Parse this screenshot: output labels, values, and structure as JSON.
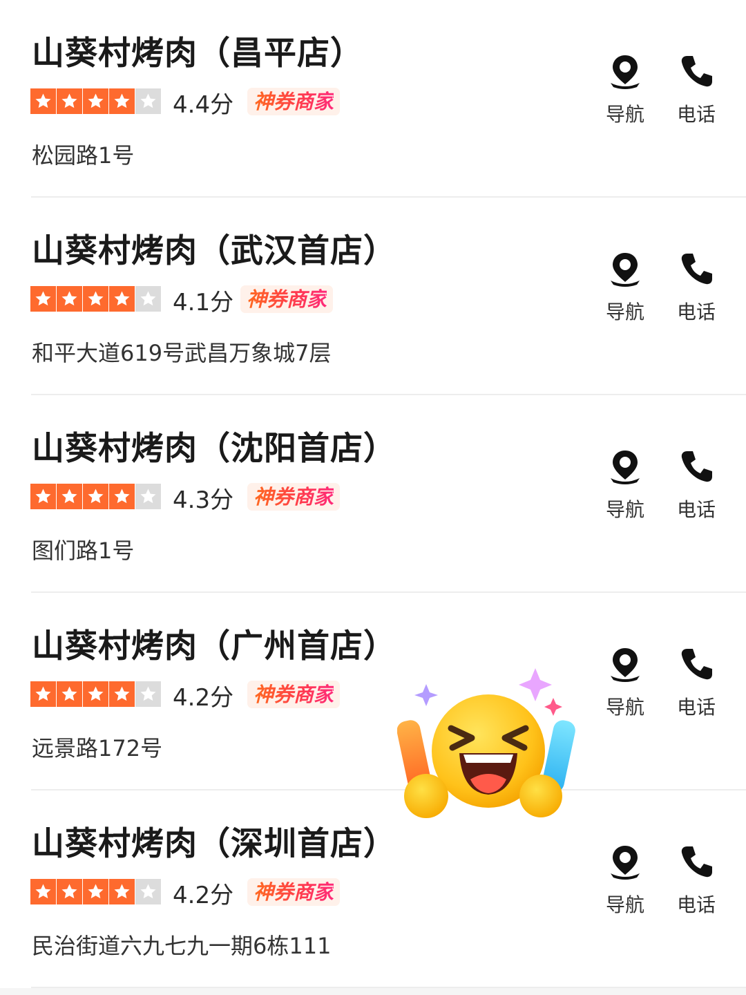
{
  "colors": {
    "star_active": "#fe6a2e",
    "star_inactive": "#dcdcdc",
    "badge_bg": "#fff1ea",
    "badge_text_gradient": [
      "#ff6a1f",
      "#ff2a7a"
    ],
    "divider": "#ededed"
  },
  "labels": {
    "nav": "导航",
    "call": "电话",
    "badge": "神券商家"
  },
  "icons": {
    "nav": "location-pin-icon",
    "call": "phone-icon",
    "star": "star-icon",
    "sticker": "laughing-face-emoji"
  },
  "stores": [
    {
      "name": "山葵村烤肉（昌平店）",
      "rating_stars": 4,
      "rating_max": 5,
      "score": "4.4分",
      "address": "松园路1号"
    },
    {
      "name": "山葵村烤肉（武汉首店）",
      "rating_stars": 4,
      "rating_max": 5,
      "score": "4.1分",
      "address": "和平大道619号武昌万象城7层"
    },
    {
      "name": "山葵村烤肉（沈阳首店）",
      "rating_stars": 4,
      "rating_max": 5,
      "score": "4.3分",
      "address": "图们路1号"
    },
    {
      "name": "山葵村烤肉（广州首店）",
      "rating_stars": 4,
      "rating_max": 5,
      "score": "4.2分",
      "address": "远景路172号"
    },
    {
      "name": "山葵村烤肉（深圳首店）",
      "rating_stars": 4,
      "rating_max": 5,
      "score": "4.2分",
      "address": "民治街道六九七九一期6栋111"
    }
  ]
}
